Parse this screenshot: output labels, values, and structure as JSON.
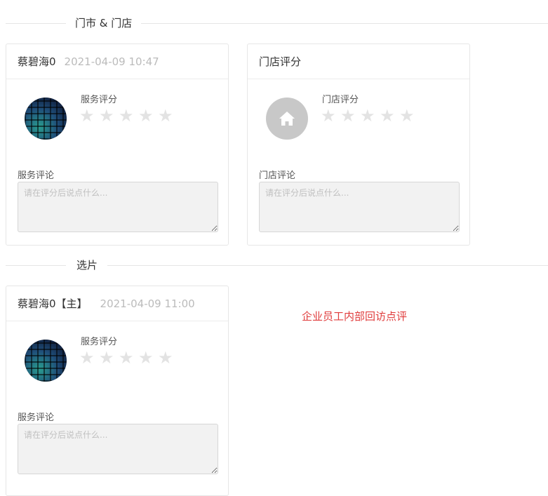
{
  "sections": {
    "first": {
      "label": "门市 & 门店"
    },
    "second": {
      "label": "选片"
    }
  },
  "cards": {
    "staff1": {
      "name": "蔡碧海0",
      "time": "2021-04-09 10:47",
      "rating_label": "服务评分",
      "rating": 0,
      "max_rating": 5,
      "comment_label": "服务评论",
      "comment_placeholder": "请在评分后说点什么..."
    },
    "store": {
      "title": "门店评分",
      "rating_label": "门店评分",
      "rating": 0,
      "max_rating": 5,
      "comment_label": "门店评论",
      "comment_placeholder": "请在评分后说点什么..."
    },
    "staff2": {
      "name": "蔡碧海0【主】",
      "time": "2021-04-09 11:00",
      "rating_label": "服务评分",
      "rating": 0,
      "max_rating": 5,
      "comment_label": "服务评论",
      "comment_placeholder": "请在评分后说点什么..."
    }
  },
  "note": "企业员工内部回访点评",
  "colors": {
    "note": "#e03c3c",
    "star_empty": "#e3e3e3",
    "store_avatar": "#c8c8c8"
  },
  "icons": {
    "store_avatar": "home-icon",
    "star": "star-icon"
  }
}
